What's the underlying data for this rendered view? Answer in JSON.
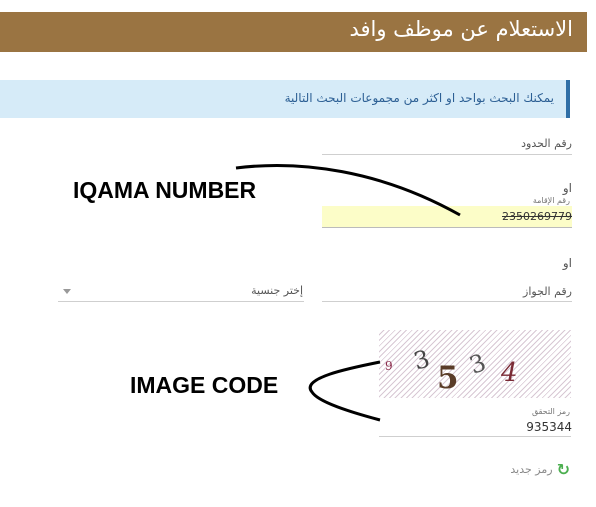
{
  "header": {
    "title": "الاستعلام عن موظف وافد"
  },
  "info": {
    "text": "يمكنك البحث بواحد او اكثر من مجموعات البحث التالية"
  },
  "form": {
    "border_number_label": "رقم الحدود",
    "or_1": "او",
    "iqama_label": "رقم الإقامة",
    "iqama_value": "2350269779",
    "or_2": "او",
    "passport_label": "رقم الجواز",
    "nationality_placeholder": "إختر جنسية",
    "captcha_digits": [
      "9",
      "3",
      "5",
      "3",
      "4"
    ],
    "captcha_label": "رمز التحقق",
    "captcha_value": "935344",
    "refresh_label": "رمز جديد"
  },
  "annotations": {
    "iqama": "IQAMA NUMBER",
    "image_code": "IMAGE CODE"
  },
  "colors": {
    "header_bg": "#9a7442",
    "info_bg": "#d6ebf8",
    "iqama_highlight": "#fcfdc8",
    "refresh_icon": "#4caf50"
  },
  "icons": {
    "refresh": "refresh-icon",
    "dropdown": "chevron-down-icon"
  }
}
